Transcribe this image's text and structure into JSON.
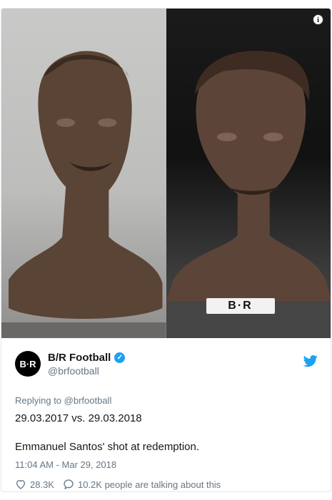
{
  "media": {
    "badge_text": "B·R",
    "info_glyph": "i"
  },
  "tweet": {
    "avatar_text": "B·R",
    "display_name": "B/R Football",
    "verified_glyph": "✓",
    "handle": "@brfootball",
    "reply_prefix": "Replying to ",
    "reply_handle": "@brfootball",
    "line1": "29.03.2017 vs. 29.03.2018",
    "line2": "Emmanuel Santos' shot at redemption.",
    "timestamp": "11:04 AM - Mar 29, 2018",
    "likes": "28.3K",
    "talking": "10.2K people are talking about this"
  },
  "colors": {
    "accent": "#1da1f2",
    "muted": "#657786",
    "text": "#14171a"
  },
  "icons": [
    "info-icon",
    "verified-icon",
    "twitter-bird-icon",
    "heart-icon",
    "speech-bubble-icon"
  ]
}
